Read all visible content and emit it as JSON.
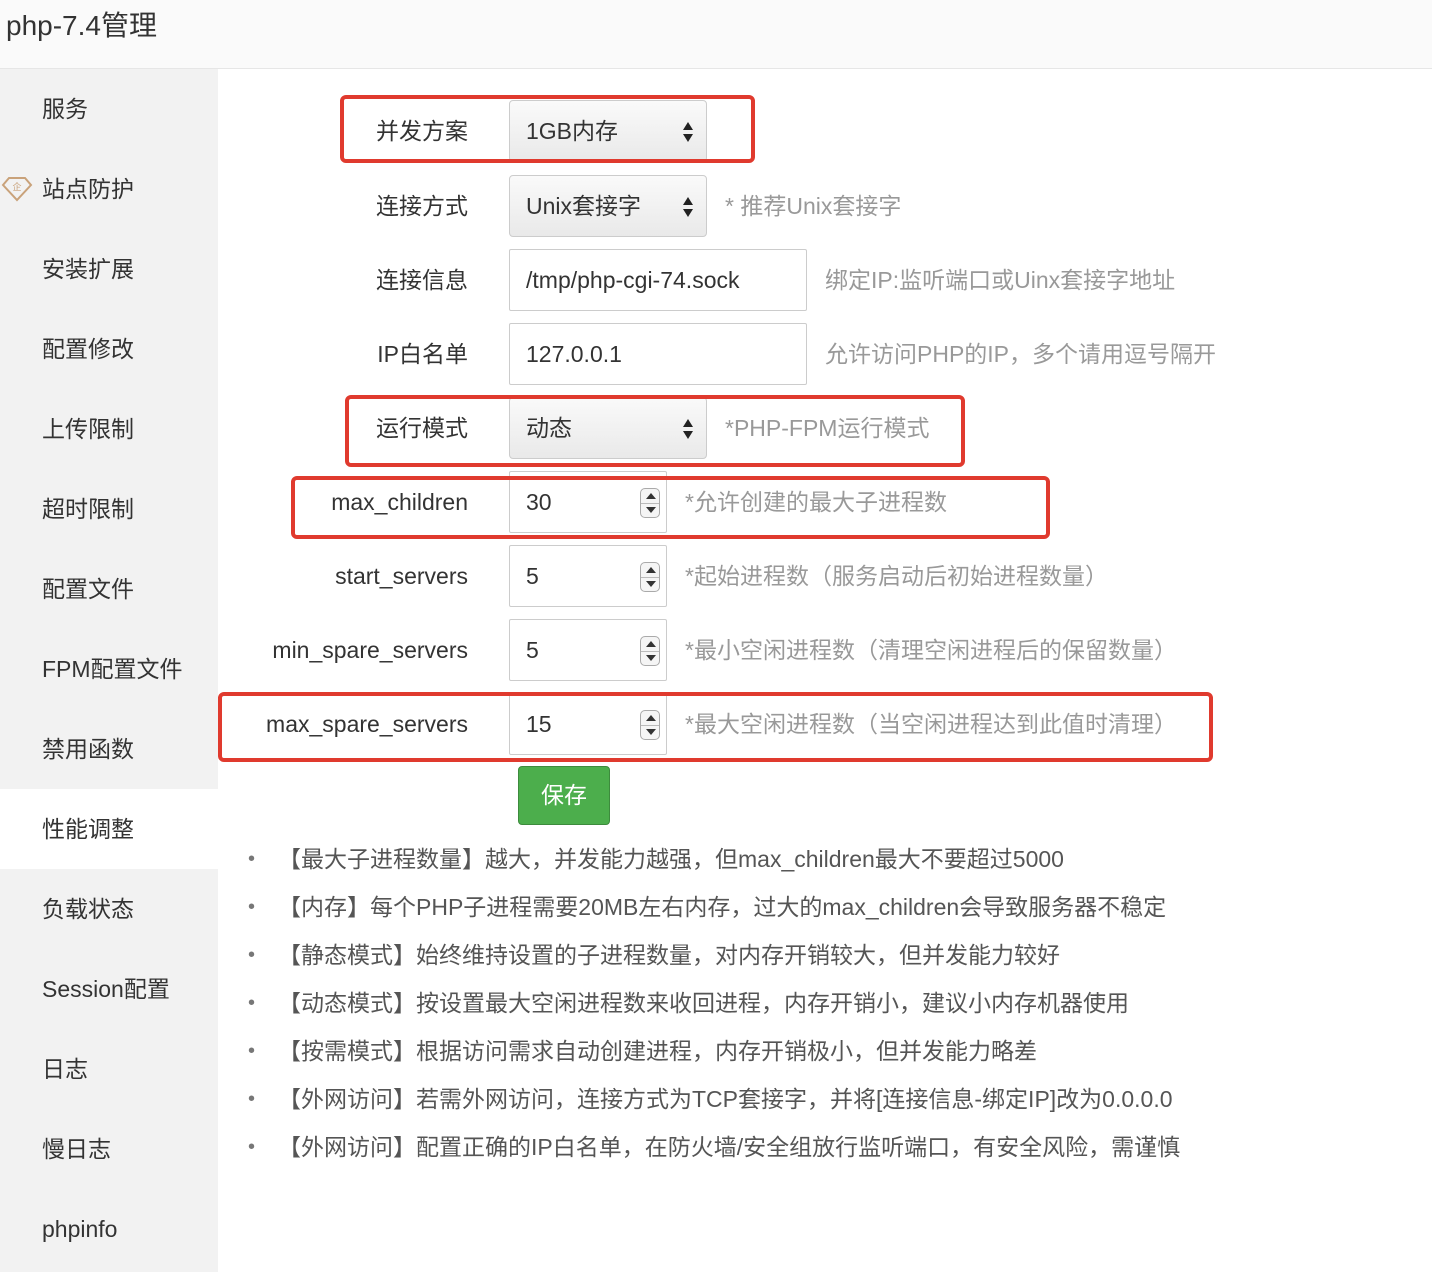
{
  "window": {
    "title": "php-7.4管理"
  },
  "sidebar": {
    "items": [
      {
        "label": "服务"
      },
      {
        "label": "站点防护"
      },
      {
        "label": "安装扩展"
      },
      {
        "label": "配置修改"
      },
      {
        "label": "上传限制"
      },
      {
        "label": "超时限制"
      },
      {
        "label": "配置文件"
      },
      {
        "label": "FPM配置文件"
      },
      {
        "label": "禁用函数"
      },
      {
        "label": "性能调整"
      },
      {
        "label": "负载状态"
      },
      {
        "label": "Session配置"
      },
      {
        "label": "日志"
      },
      {
        "label": "慢日志"
      },
      {
        "label": "phpinfo"
      }
    ],
    "active_item": "性能调整",
    "vip_badge": "企"
  },
  "form": {
    "concurrency": {
      "label": "并发方案",
      "value": "1GB内存"
    },
    "connect_mode": {
      "label": "连接方式",
      "value": "Unix套接字",
      "hint": "* 推荐Unix套接字"
    },
    "connect_info": {
      "label": "连接信息",
      "value": "/tmp/php-cgi-74.sock",
      "hint": "绑定IP:监听端口或Uinx套接字地址"
    },
    "ip_whitelist": {
      "label": "IP白名单",
      "value": "127.0.0.1",
      "hint": "允许访问PHP的IP，多个请用逗号隔开"
    },
    "run_mode": {
      "label": "运行模式",
      "value": "动态",
      "hint": "*PHP-FPM运行模式"
    },
    "max_children": {
      "label": "max_children",
      "value": "30",
      "hint": "*允许创建的最大子进程数"
    },
    "start_servers": {
      "label": "start_servers",
      "value": "5",
      "hint": "*起始进程数（服务启动后初始进程数量）"
    },
    "min_spare_servers": {
      "label": "min_spare_servers",
      "value": "5",
      "hint": "*最小空闲进程数（清理空闲进程后的保留数量）"
    },
    "max_spare_servers": {
      "label": "max_spare_servers",
      "value": "15",
      "hint": "*最大空闲进程数（当空闲进程达到此值时清理）"
    },
    "save_label": "保存"
  },
  "tips": [
    "【最大子进程数量】越大，并发能力越强，但max_children最大不要超过5000",
    "【内存】每个PHP子进程需要20MB左右内存，过大的max_children会导致服务器不稳定",
    "【静态模式】始终维持设置的子进程数量，对内存开销较大，但并发能力较好",
    "【动态模式】按设置最大空闲进程数来收回进程，内存开销小，建议小内存机器使用",
    "【按需模式】根据访问需求自动创建进程，内存开销极小，但并发能力略差",
    "【外网访问】若需外网访问，连接方式为TCP套接字，并将[连接信息-绑定IP]改为0.0.0.0",
    "【外网访问】配置正确的IP白名单，在防火墙/安全组放行监听端口，有安全风险，需谨慎"
  ],
  "colors": {
    "highlight": "#e03a2e",
    "save_button": "#4cae4c",
    "sidebar_bg": "#f2f2f2",
    "hint_text": "#999999"
  }
}
